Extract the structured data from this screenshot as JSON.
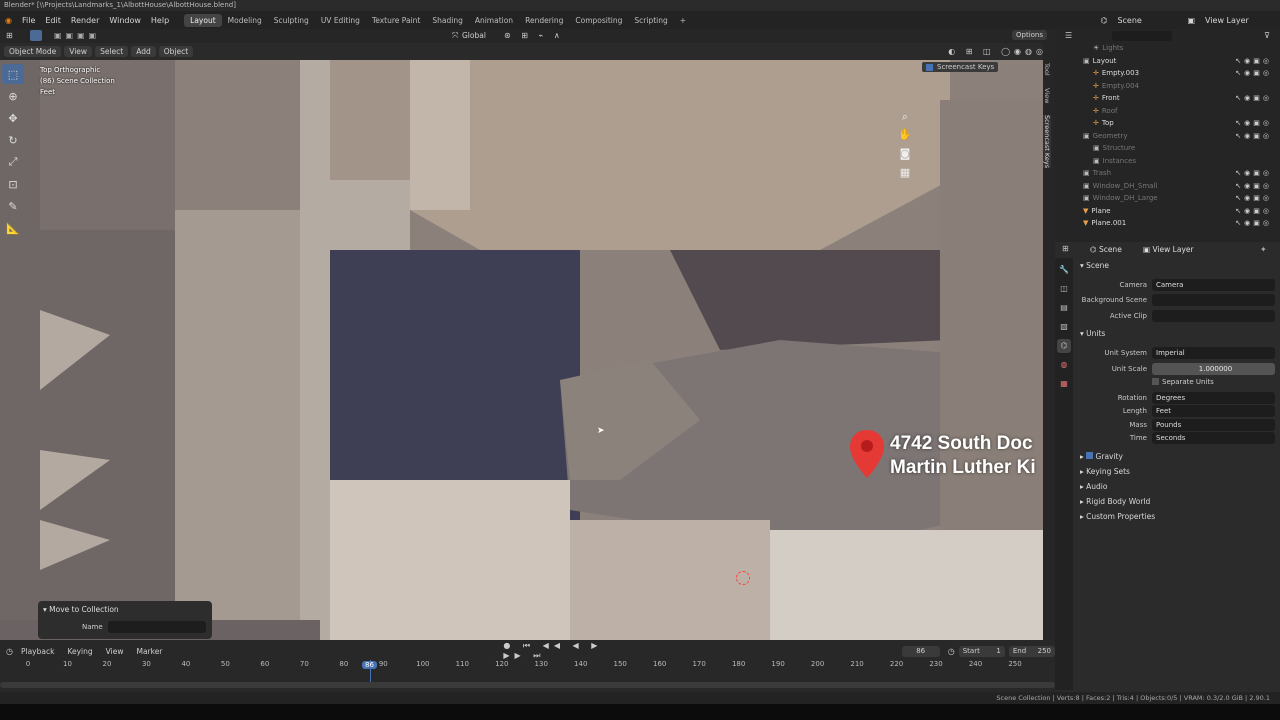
{
  "window": {
    "title": "Blender* [\\\\Projects\\Landmarks_1\\AlbottHouse\\AlbottHouse.blend]"
  },
  "menus": [
    "File",
    "Edit",
    "Render",
    "Window",
    "Help"
  ],
  "workspaces": [
    "Layout",
    "Modeling",
    "Sculpting",
    "UV Editing",
    "Texture Paint",
    "Shading",
    "Animation",
    "Rendering",
    "Compositing",
    "Scripting"
  ],
  "active_workspace": "Layout",
  "scene_selector": "Scene",
  "view_layer_selector": "View Layer",
  "header": {
    "transform_orientation": "Global",
    "options_label": "Options"
  },
  "viewport_header": {
    "mode": "Object Mode",
    "view": "View",
    "select": "Select",
    "add": "Add",
    "object": "Object"
  },
  "viewport_info": {
    "line1": "Top Orthographic",
    "line2": "(86) Scene Collection",
    "line3": "Feet"
  },
  "screencast_keys": "Screencast Keys",
  "side_tabs": [
    "Tool",
    "View",
    "Screencast Keys"
  ],
  "map_label": {
    "line1": "4742 South Doc",
    "line2": "Martin Luther Ki"
  },
  "redo_panel": {
    "title": "Move to Collection",
    "name_label": "Name",
    "name_value": ""
  },
  "outliner": {
    "search_placeholder": "",
    "rows": [
      {
        "name": "Lights",
        "indent": 2,
        "dim": true
      },
      {
        "name": "Layout",
        "indent": 1,
        "dim": false
      },
      {
        "name": "Empty.003",
        "indent": 2,
        "dim": false
      },
      {
        "name": "Empty.004",
        "indent": 2,
        "dim": true
      },
      {
        "name": "Front",
        "indent": 2,
        "dim": false
      },
      {
        "name": "Roof",
        "indent": 2,
        "dim": true
      },
      {
        "name": "Top",
        "indent": 2,
        "dim": false
      },
      {
        "name": "Geometry",
        "indent": 1,
        "dim": true
      },
      {
        "name": "Structure",
        "indent": 2,
        "dim": true
      },
      {
        "name": "Instances",
        "indent": 2,
        "dim": true
      },
      {
        "name": "Trash",
        "indent": 1,
        "dim": true
      },
      {
        "name": "Window_DH_Small",
        "indent": 1,
        "dim": true
      },
      {
        "name": "Window_DH_Large",
        "indent": 1,
        "dim": true
      },
      {
        "name": "Plane",
        "indent": 1,
        "dim": false
      },
      {
        "name": "Plane.001",
        "indent": 1,
        "dim": false
      }
    ]
  },
  "properties": {
    "tabs": [
      "Scene",
      "View Layer"
    ],
    "scene_section": "Scene",
    "camera_label": "Camera",
    "camera_value": "Camera",
    "bg_scene_label": "Background Scene",
    "active_clip_label": "Active Clip",
    "units_section": "Units",
    "unit_system_label": "Unit System",
    "unit_system_value": "Imperial",
    "unit_scale_label": "Unit Scale",
    "unit_scale_value": "1.000000",
    "separate_units_label": "Separate Units",
    "rotation_label": "Rotation",
    "rotation_value": "Degrees",
    "length_label": "Length",
    "length_value": "Feet",
    "mass_label": "Mass",
    "mass_value": "Pounds",
    "time_label": "Time",
    "time_value": "Seconds",
    "gravity_label": "Gravity",
    "keying_sets_label": "Keying Sets",
    "audio_label": "Audio",
    "rigid_body_label": "Rigid Body World",
    "custom_props_label": "Custom Properties"
  },
  "timeline": {
    "playback": "Playback",
    "keying": "Keying",
    "view": "View",
    "marker": "Marker",
    "current_frame": "86",
    "start_label": "Start",
    "start_value": "1",
    "end_label": "End",
    "end_value": "250",
    "ticks": [
      "0",
      "10",
      "20",
      "30",
      "40",
      "50",
      "60",
      "70",
      "80",
      "90",
      "100",
      "110",
      "120",
      "130",
      "140",
      "150",
      "160",
      "170",
      "180",
      "190",
      "200",
      "210",
      "220",
      "230",
      "240",
      "250"
    ],
    "playhead_label": "86"
  },
  "status_bar": "Scene Collection | Verts:8 | Faces:2 | Tris:4 | Objects:0/5 | VRAM: 0.3/2.0 GiB | 2.90.1"
}
